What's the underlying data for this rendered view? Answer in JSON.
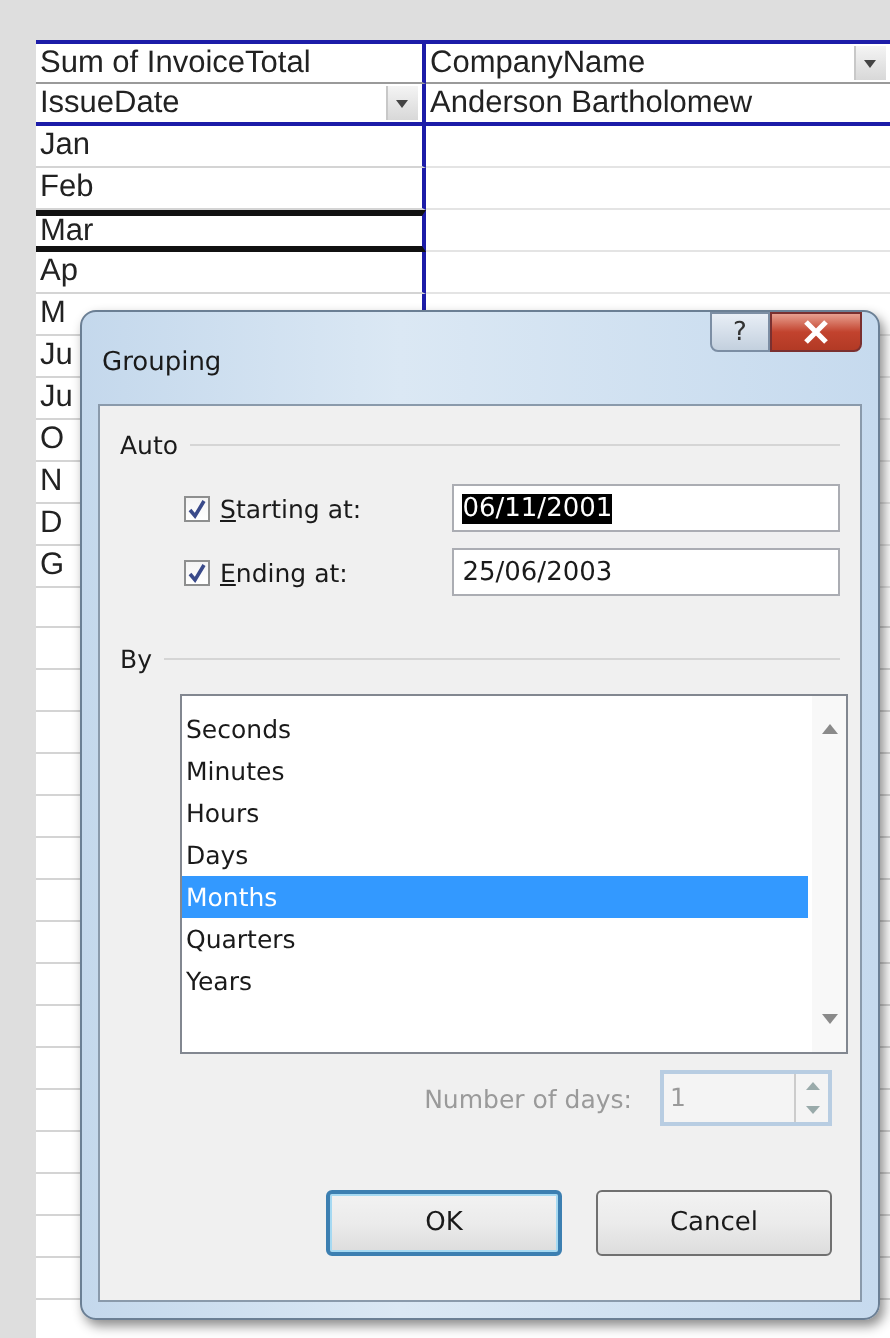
{
  "pivot": {
    "data_field": "Sum of InvoiceTotal",
    "column_field": "CompanyName",
    "row_field": "IssueDate",
    "column_item": "Anderson Bartholomew",
    "row_items": [
      {
        "label": "Jan",
        "selected": false
      },
      {
        "label": "Feb",
        "selected": false
      },
      {
        "label": "Mar",
        "selected": true
      },
      {
        "label": "Ap",
        "selected": false
      },
      {
        "label": "M",
        "selected": false
      },
      {
        "label": "Ju",
        "selected": false
      },
      {
        "label": "Ju",
        "selected": false
      },
      {
        "label": "O",
        "selected": false
      },
      {
        "label": "N",
        "selected": false
      },
      {
        "label": "D",
        "selected": false
      },
      {
        "label": "G",
        "selected": false
      }
    ]
  },
  "dialog": {
    "title": "Grouping",
    "help_button": "?",
    "auto": {
      "legend": "Auto",
      "fields": [
        {
          "access_key": "S",
          "label_rest": "tarting at:",
          "checked": true,
          "value": "06/11/2001",
          "value_selected": true
        },
        {
          "access_key": "E",
          "label_rest": "nding at:",
          "checked": true,
          "value": "25/06/2003",
          "value_selected": false
        }
      ]
    },
    "by": {
      "legend": "By",
      "items": [
        {
          "label": "Seconds",
          "selected": false
        },
        {
          "label": "Minutes",
          "selected": false
        },
        {
          "label": "Hours",
          "selected": false
        },
        {
          "label": "Days",
          "selected": false
        },
        {
          "label": "Months",
          "selected": true
        },
        {
          "label": "Quarters",
          "selected": false
        },
        {
          "label": "Years",
          "selected": false
        }
      ]
    },
    "number_of_days": {
      "label": "Number of days:",
      "value": "1",
      "disabled": true
    },
    "buttons": [
      {
        "label": "OK",
        "default": true
      },
      {
        "label": "Cancel",
        "default": false
      }
    ]
  }
}
